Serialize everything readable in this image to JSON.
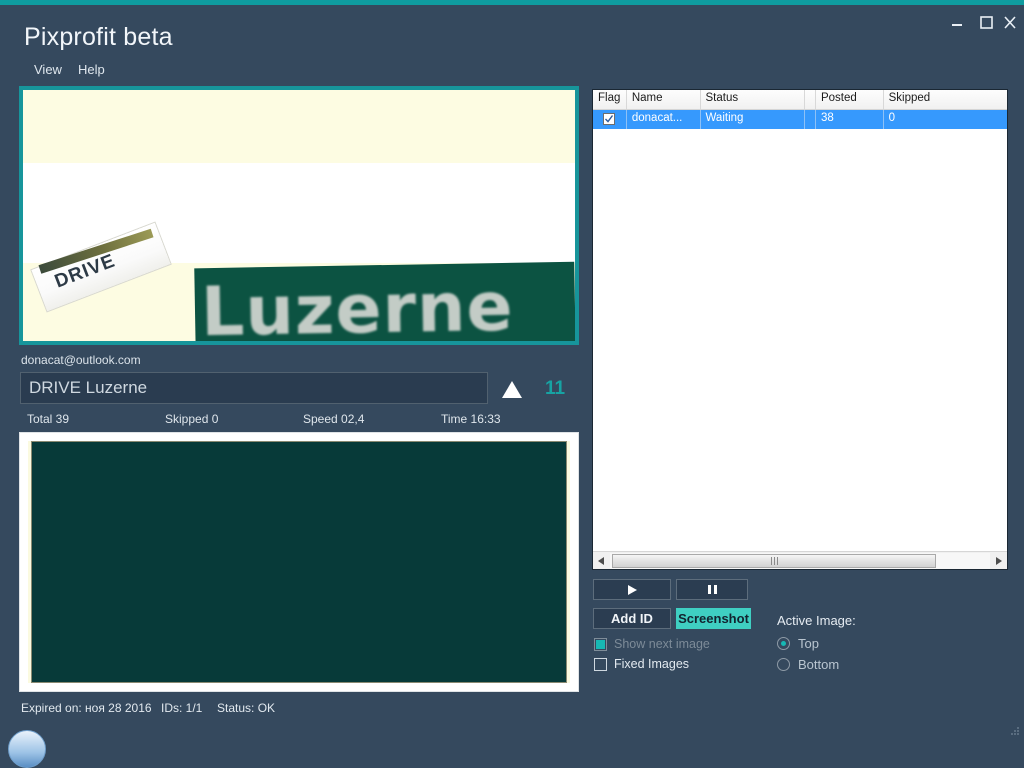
{
  "window": {
    "title": "Pixprofit beta",
    "accent_color": "#0f9ca0",
    "background_color": "#35495e",
    "controls": {
      "minimize": "minimize-icon",
      "maximize": "maximize-icon",
      "close": "close-icon"
    }
  },
  "menu": {
    "items": [
      {
        "label": "View"
      },
      {
        "label": "Help"
      }
    ]
  },
  "top_image": {
    "border_color": "#17959b",
    "background_color": "#fdfce2",
    "sign_drive_text": "DRIVE",
    "sign_street_text": "Luzerne",
    "sign_street_color": "#0c5342"
  },
  "account": {
    "email": "donacat@outlook.com"
  },
  "answer": {
    "value": "DRIVE Luzerne",
    "placeholder": "",
    "submit_icon": "up-arrow-icon",
    "counter": "11",
    "counter_color": "#17a3a3"
  },
  "stats": {
    "total": "Total 39",
    "skipped": "Skipped 0",
    "speed": "Speed 02,4",
    "time": "Time 16:33"
  },
  "bottom_image": {
    "background_color": "#073a39",
    "stripe_color": "#fbfae0"
  },
  "footer": {
    "expired": "Expired on: ноя 28 2016",
    "ids": "IDs: 1/1",
    "status": "Status: OK"
  },
  "table": {
    "columns": [
      "Flag",
      "Name",
      "Status",
      "",
      "Posted",
      "Skipped"
    ],
    "rows": [
      {
        "flag_checked": true,
        "name": "donacat...",
        "status": "Waiting",
        "narrow": "",
        "posted": "38",
        "skipped": "0",
        "selected": true
      }
    ],
    "scrollbar": {
      "left_arrow": "scroll-left-icon",
      "right_arrow": "scroll-right-icon",
      "thumb_grip": "grip-icon"
    }
  },
  "controls": {
    "play_label": "▶",
    "pause_label": "❙❙",
    "add_id_label": "Add ID",
    "screenshot_label": "Screenshot",
    "screenshot_color": "#3fcfc2",
    "checkboxes": [
      {
        "label": "Show next image",
        "checked": true,
        "disabled": true
      },
      {
        "label": "Fixed Images",
        "checked": false,
        "disabled": false
      }
    ],
    "active_image": {
      "label": "Active Image:",
      "options": [
        {
          "label": "Top",
          "selected": true
        },
        {
          "label": "Bottom",
          "selected": false
        }
      ]
    }
  }
}
